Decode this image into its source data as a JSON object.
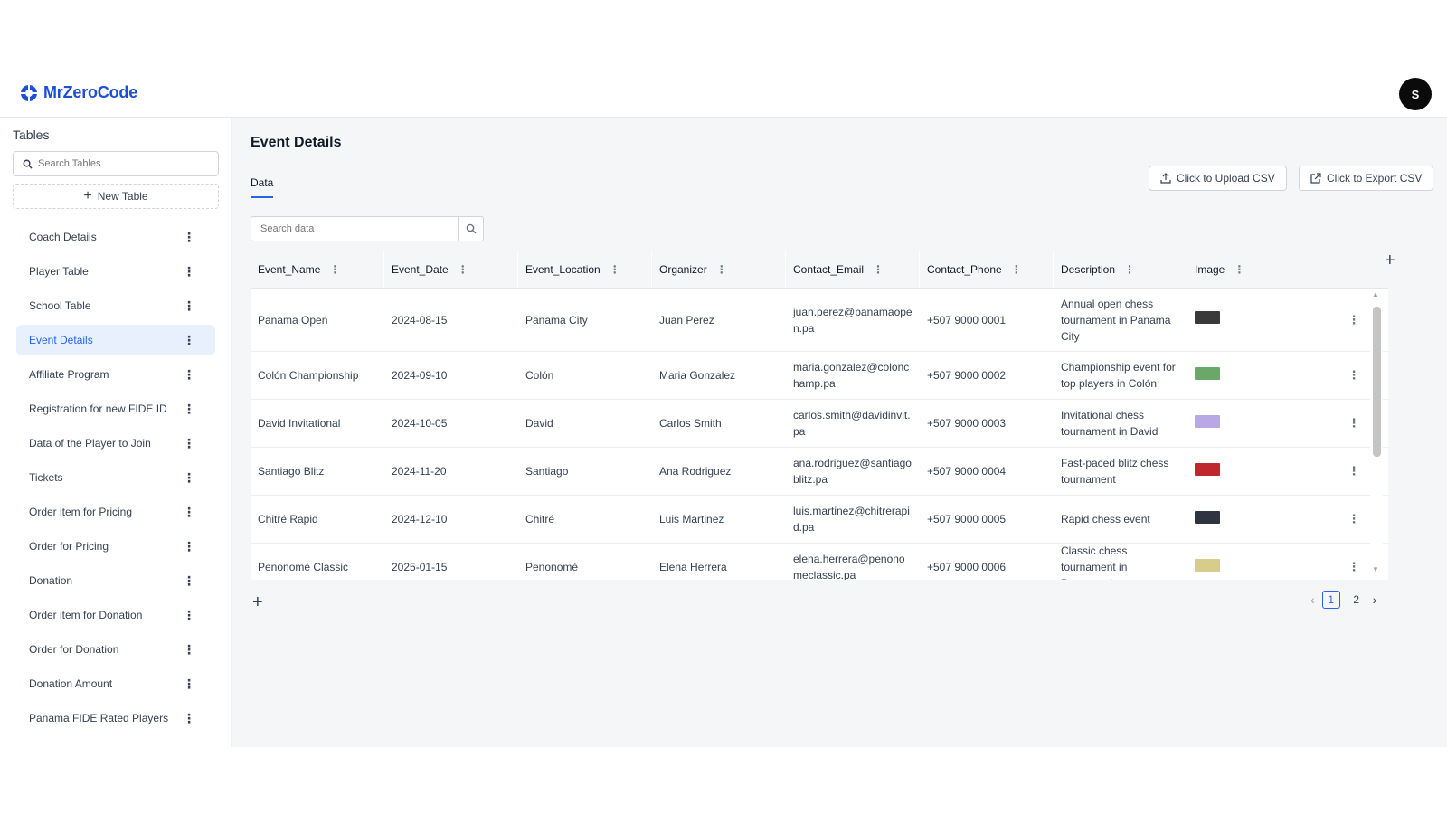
{
  "app": {
    "name": "MrZeroCode",
    "user_initial": "S",
    "brand_color": "#1d4ed8"
  },
  "sidebar": {
    "title": "Tables",
    "search_placeholder": "Search Tables",
    "new_table_label": "New Table",
    "items": [
      {
        "label": "Coach Details",
        "active": false
      },
      {
        "label": "Player Table",
        "active": false
      },
      {
        "label": "School Table",
        "active": false
      },
      {
        "label": "Event Details",
        "active": true
      },
      {
        "label": "Affiliate Program",
        "active": false
      },
      {
        "label": "Registration for new FIDE ID",
        "active": false
      },
      {
        "label": "Data of the Player to Join",
        "active": false
      },
      {
        "label": "Tickets",
        "active": false
      },
      {
        "label": "Order item for Pricing",
        "active": false
      },
      {
        "label": "Order for Pricing",
        "active": false
      },
      {
        "label": "Donation",
        "active": false
      },
      {
        "label": "Order item for Donation",
        "active": false
      },
      {
        "label": "Order for Donation",
        "active": false
      },
      {
        "label": "Donation Amount",
        "active": false
      },
      {
        "label": "Panama FIDE Rated Players",
        "active": false
      }
    ]
  },
  "main": {
    "title": "Event Details",
    "tabs": [
      {
        "label": "Data",
        "active": true
      }
    ],
    "upload_label": "Click to Upload CSV",
    "export_label": "Click to Export CSV",
    "search_placeholder": "Search data",
    "columns": [
      "Event_Name",
      "Event_Date",
      "Event_Location",
      "Organizer",
      "Contact_Email",
      "Contact_Phone",
      "Description",
      "Image"
    ],
    "rows": [
      {
        "height": 70,
        "cells": [
          "Panama Open",
          "2024-08-15",
          "Panama City",
          "Juan Perez",
          "juan.perez@panamaopen.pa",
          "+507 9000 0001",
          "Annual open chess tournament in Panama City"
        ],
        "thumb": "#3a3a3a"
      },
      {
        "height": 53,
        "cells": [
          "Colón Championship",
          "2024-09-10",
          "Colón",
          "Maria Gonzalez",
          "maria.gonzalez@colonchamp.pa",
          "+507 9000 0002",
          "Championship event for top players in Colón"
        ],
        "thumb": "#6aa86a"
      },
      {
        "height": 53,
        "cells": [
          "David Invitational",
          "2024-10-05",
          "David",
          "Carlos Smith",
          "carlos.smith@davidinvit.pa",
          "+507 9000 0003",
          "Invitational chess tournament in David"
        ],
        "thumb": "#b9a8e6"
      },
      {
        "height": 53,
        "cells": [
          "Santiago Blitz",
          "2024-11-20",
          "Santiago",
          "Ana Rodriguez",
          "ana.rodriguez@santiagoblitz.pa",
          "+507 9000 0004",
          "Fast-paced blitz chess tournament"
        ],
        "thumb": "#c0262d"
      },
      {
        "height": 53,
        "cells": [
          "Chitré Rapid",
          "2024-12-10",
          "Chitré",
          "Luis Martinez",
          "luis.martinez@chitrerapid.pa",
          "+507 9000 0005",
          "Rapid chess event"
        ],
        "thumb": "#2e3440"
      },
      {
        "height": 53,
        "cells": [
          "Penonomé Classic",
          "2025-01-15",
          "Penonomé",
          "Elena Herrera",
          "elena.herrera@penonomeclassic.pa",
          "+507 9000 0006",
          "Classic chess tournament in Penonomé"
        ],
        "thumb": "#d8cc8a"
      }
    ],
    "pagination": {
      "pages": [
        "1",
        "2"
      ],
      "current": "1"
    }
  }
}
